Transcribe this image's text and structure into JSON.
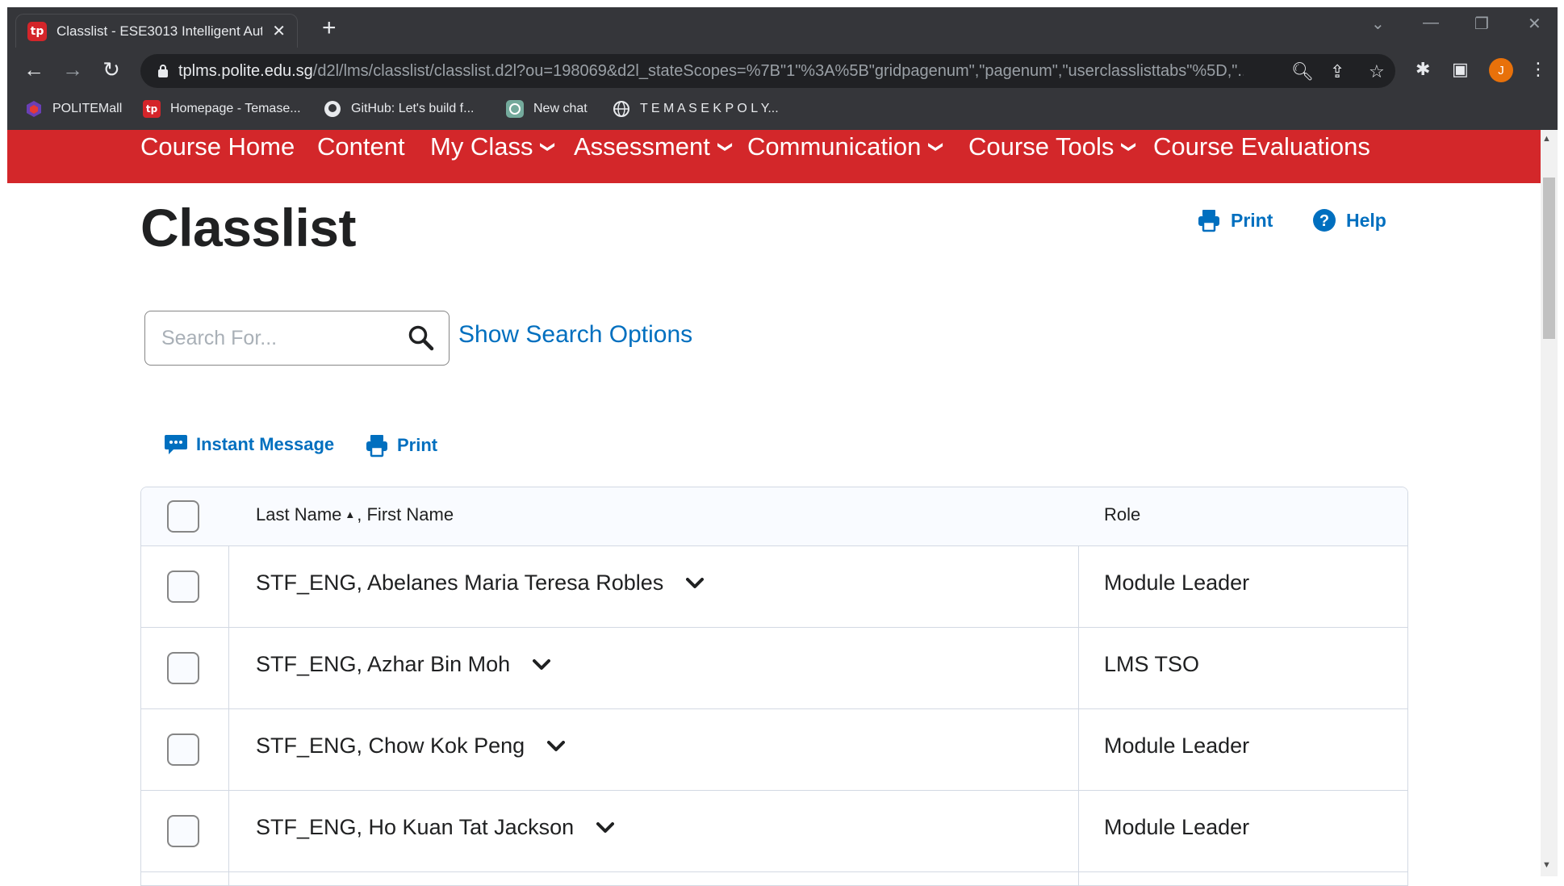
{
  "browser": {
    "tab_title": "Classlist - ESE3013 Intelligent Auto",
    "new_tab_symbol": "+",
    "url_main": "tplms.polite.edu.sg",
    "url_rest": "/d2l/lms/classlist/classlist.d2l?ou=198069&d2l_stateScopes=%7B\"1\"%3A%5B\"gridpagenum\",\"pagenum\",\"userclasslisttabs\"%5D,\"...",
    "profile_initial": "J",
    "bookmarks": [
      {
        "label": "POLITEMall"
      },
      {
        "label": "Homepage - Temase..."
      },
      {
        "label": "GitHub: Let's build f..."
      },
      {
        "label": "New chat"
      },
      {
        "label": "T E M A S E K P O L Y..."
      }
    ]
  },
  "course_nav": {
    "items": [
      {
        "label": "Course Home"
      },
      {
        "label": "Content"
      },
      {
        "label": "My Class"
      },
      {
        "label": "Assessment"
      },
      {
        "label": "Communication"
      },
      {
        "label": "Course Tools"
      },
      {
        "label": "Course Evaluations"
      }
    ]
  },
  "page": {
    "title": "Classlist",
    "print_label": "Print",
    "help_label": "Help"
  },
  "search": {
    "placeholder": "Search For...",
    "options_label": "Show Search Options"
  },
  "actions": {
    "instant_message_label": "Instant Message",
    "print_label": "Print"
  },
  "table": {
    "header_last_name": "Last Name",
    "header_first_name": ", First Name",
    "header_role": "Role",
    "rows": [
      {
        "name": "STF_ENG, Abelanes Maria Teresa Robles",
        "role": "Module Leader"
      },
      {
        "name": "STF_ENG, Azhar Bin Moh",
        "role": "LMS TSO"
      },
      {
        "name": "STF_ENG, Chow Kok Peng",
        "role": "Module Leader"
      },
      {
        "name": "STF_ENG, Ho Kuan Tat Jackson",
        "role": "Module Leader"
      }
    ]
  },
  "colors": {
    "brand_red": "#d3272a",
    "link_blue": "#006fbf",
    "chrome_dark": "#35363a"
  }
}
